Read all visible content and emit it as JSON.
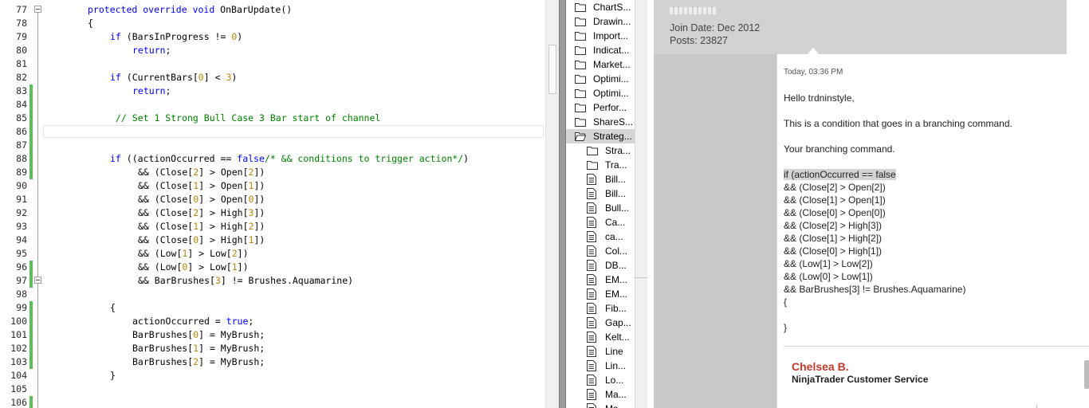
{
  "editor": {
    "lines": [
      {
        "n": "77"
      },
      {
        "n": "78"
      },
      {
        "n": "79"
      },
      {
        "n": "80"
      },
      {
        "n": "81"
      },
      {
        "n": "82"
      },
      {
        "n": "83"
      },
      {
        "n": "84"
      },
      {
        "n": "85"
      },
      {
        "n": "86"
      },
      {
        "n": "87"
      },
      {
        "n": "88"
      },
      {
        "n": "89"
      },
      {
        "n": "90"
      },
      {
        "n": "91"
      },
      {
        "n": "92"
      },
      {
        "n": "93"
      },
      {
        "n": "94"
      },
      {
        "n": "95"
      },
      {
        "n": "96"
      },
      {
        "n": "97"
      },
      {
        "n": "98"
      },
      {
        "n": "99"
      },
      {
        "n": "100"
      },
      {
        "n": "101"
      },
      {
        "n": "102"
      },
      {
        "n": "103"
      },
      {
        "n": "104"
      },
      {
        "n": "105"
      },
      {
        "n": "106"
      }
    ],
    "code": {
      "l77_kw": "protected override void",
      "l77_rest": " OnBarUpdate()",
      "l78": "{",
      "l79_kw": "if",
      "l79_a": " (BarsInProgress != ",
      "l79_n": "0",
      "l79_b": ")",
      "l80_kw": "return",
      "l80_b": ";",
      "l82_kw": "if",
      "l82_a": " (CurrentBars[",
      "l82_n1": "0",
      "l82_b": "] < ",
      "l82_n2": "3",
      "l82_c": ")",
      "l83_kw": "return",
      "l83_b": ";",
      "l85_cm": "// Set 1 Strong Bull Case 3 Bar start of channel",
      "l88_kw": "if",
      "l88_a": " ((actionOccurred == ",
      "l88_kw2": "false",
      "l88_cm": "/* && conditions to trigger action*/",
      "l88_b": ")",
      "l89_a": "&& (Close[",
      "l89_n1": "2",
      "l89_b": "] > Open[",
      "l89_n2": "2",
      "l89_c": "])",
      "l90_a": "&& (Close[",
      "l90_n1": "1",
      "l90_b": "] > Open[",
      "l90_n2": "1",
      "l90_c": "])",
      "l91_a": "&& (Close[",
      "l91_n1": "0",
      "l91_b": "] > Open[",
      "l91_n2": "0",
      "l91_c": "])",
      "l92_a": "&& (Close[",
      "l92_n1": "2",
      "l92_b": "] > High[",
      "l92_n2": "3",
      "l92_c": "])",
      "l93_a": "&& (Close[",
      "l93_n1": "1",
      "l93_b": "] > High[",
      "l93_n2": "2",
      "l93_c": "])",
      "l94_a": "&& (Close[",
      "l94_n1": "0",
      "l94_b": "] > High[",
      "l94_n2": "1",
      "l94_c": "])",
      "l95_a": "&& (Low[",
      "l95_n1": "1",
      "l95_b": "] > Low[",
      "l95_n2": "2",
      "l95_c": "])",
      "l96_a": "&& (Low[",
      "l96_n1": "0",
      "l96_b": "] > Low[",
      "l96_n2": "1",
      "l96_c": "])",
      "l97_a": "&& BarBrushes[",
      "l97_n1": "3",
      "l97_b": "] != Brushes.Aquamarine)",
      "l99": "{",
      "l100_a": "actionOccurred = ",
      "l100_kw": "true",
      "l100_b": ";",
      "l101_a": "BarBrushes[",
      "l101_n": "0",
      "l101_b": "] = MyBrush;",
      "l102_a": "BarBrushes[",
      "l102_n": "1",
      "l102_b": "] = MyBrush;",
      "l103_a": "BarBrushes[",
      "l103_n": "2",
      "l103_b": "] = MyBrush;",
      "l104": "}"
    }
  },
  "explorer": {
    "items": [
      {
        "label": "ChartS...",
        "icon": "folder-icon"
      },
      {
        "label": "Drawin...",
        "icon": "folder-icon"
      },
      {
        "label": "Import...",
        "icon": "folder-icon"
      },
      {
        "label": "Indicat...",
        "icon": "folder-icon"
      },
      {
        "label": "Market...",
        "icon": "folder-icon"
      },
      {
        "label": "Optimi...",
        "icon": "folder-icon"
      },
      {
        "label": "Optimi...",
        "icon": "folder-icon"
      },
      {
        "label": "Perfor...",
        "icon": "folder-icon"
      },
      {
        "label": "ShareS...",
        "icon": "folder-icon"
      },
      {
        "label": "Strateg...",
        "icon": "folder-open-icon",
        "selected": true
      },
      {
        "label": "Stra...",
        "icon": "folder-icon"
      },
      {
        "label": "Tra...",
        "icon": "folder-icon"
      },
      {
        "label": "Bill...",
        "icon": "file-icon"
      },
      {
        "label": "Bill...",
        "icon": "file-icon"
      },
      {
        "label": "Bull...",
        "icon": "file-icon"
      },
      {
        "label": "Ca...",
        "icon": "file-icon"
      },
      {
        "label": "ca...",
        "icon": "file-icon"
      },
      {
        "label": "Col...",
        "icon": "file-icon"
      },
      {
        "label": "DB...",
        "icon": "file-icon"
      },
      {
        "label": "EM...",
        "icon": "file-icon"
      },
      {
        "label": "EM...",
        "icon": "file-icon"
      },
      {
        "label": "Fib...",
        "icon": "file-icon"
      },
      {
        "label": "Gap...",
        "icon": "file-icon"
      },
      {
        "label": "Kelt...",
        "icon": "file-icon"
      },
      {
        "label": "Line",
        "icon": "file-icon"
      },
      {
        "label": "Lin...",
        "icon": "file-icon"
      },
      {
        "label": "Lo...",
        "icon": "file-icon"
      },
      {
        "label": "Ma...",
        "icon": "file-icon"
      },
      {
        "label": "Ma...",
        "icon": "file-icon"
      }
    ]
  },
  "forum": {
    "user": {
      "join_date": "Join Date: Dec 2012",
      "posts": "Posts: 23827"
    },
    "post": {
      "time": "Today, 03:36 PM",
      "greeting": "Hello trdninstyle,",
      "p1": "This is a condition that goes in a branching command.",
      "p2": "Your branching command.",
      "code_lines": [
        "if (actionOccurred == false",
        "&& (Close[2] > Open[2])",
        "&& (Close[1] > Open[1])",
        "&& (Close[0] > Open[0])",
        "&& (Close[2] > High[3])",
        "&& (Close[1] > High[2])",
        "&& (Close[0] > High[1])",
        "&& (Low[1] > Low[2])",
        "&& (Low[0] > Low[1])",
        "&& BarBrushes[3] != Brushes.Aquamarine)",
        "{",
        "}"
      ]
    },
    "signature": {
      "name": "Chelsea B.",
      "title": "NinjaTrader Customer Service"
    }
  },
  "colors": {
    "keyword": "#0000ff",
    "comment": "#008000",
    "number": "#b8860b",
    "changebar": "#5cbf5a",
    "signature_name": "#c0392b"
  }
}
